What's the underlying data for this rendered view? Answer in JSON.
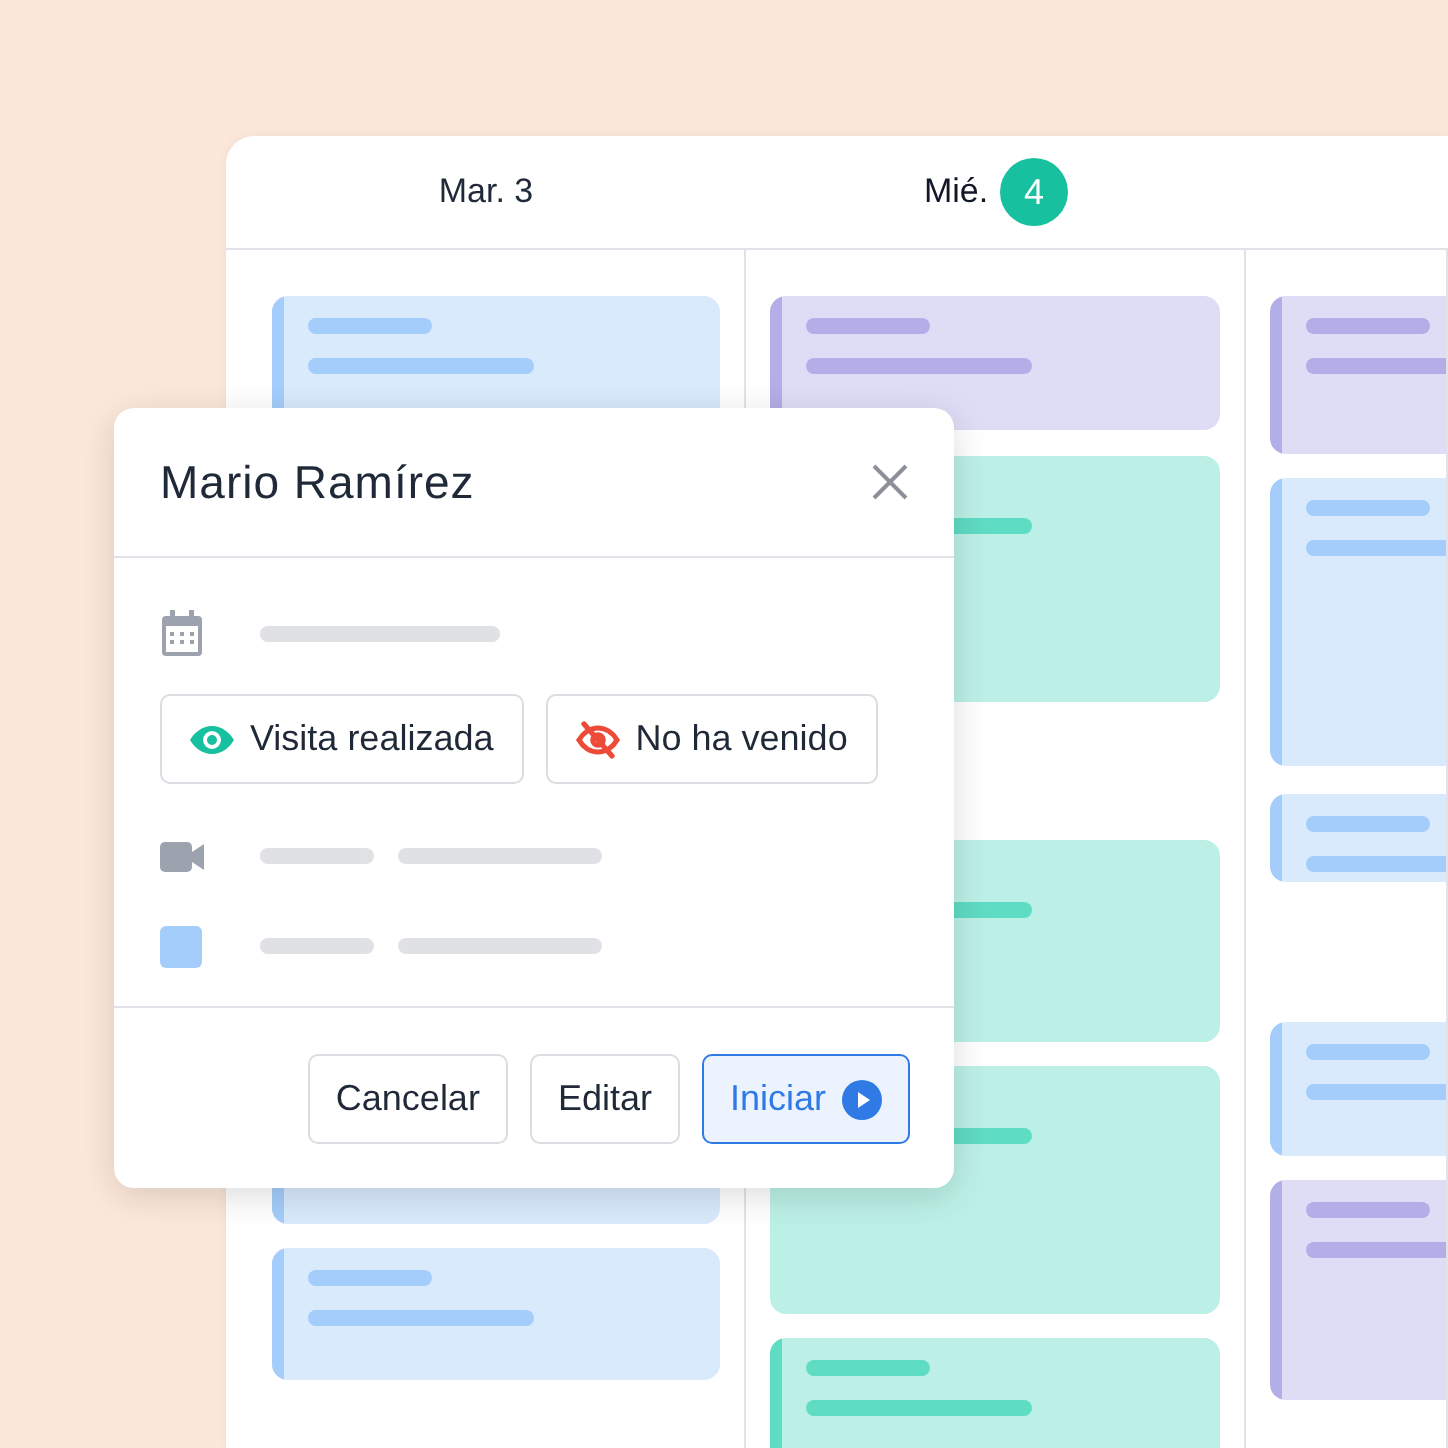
{
  "calendar": {
    "days": [
      {
        "label": "Mar. 3",
        "events": [
          {
            "color": "#a4cdfb"
          },
          {
            "color": "#a4cdfb"
          },
          {
            "color": "#a4cdfb"
          }
        ]
      },
      {
        "label": "Mié.",
        "badge": "4",
        "today": true,
        "events": [
          {
            "color": "#b3ade8"
          },
          {
            "color": "#5fdcc4"
          },
          {
            "color": "#5fdcc4"
          },
          {
            "color": "#5fdcc4"
          },
          {
            "color": "#5fdcc4"
          }
        ]
      },
      {
        "events": [
          {
            "color": "#b3ade8"
          },
          {
            "color": "#a4cdfb"
          },
          {
            "color": "#a4cdfb"
          },
          {
            "color": "#a4cdfb"
          },
          {
            "color": "#b3ade8"
          }
        ]
      }
    ]
  },
  "popup": {
    "title": "Mario Ramírez",
    "status_buttons": [
      {
        "label": "Visita realizada",
        "kind": "done"
      },
      {
        "label": "No ha venido",
        "kind": "absent"
      }
    ],
    "actions": [
      {
        "label": "Cancelar",
        "kind": "default"
      },
      {
        "label": "Editar",
        "kind": "default"
      },
      {
        "label": "Iniciar",
        "kind": "primary"
      }
    ]
  }
}
